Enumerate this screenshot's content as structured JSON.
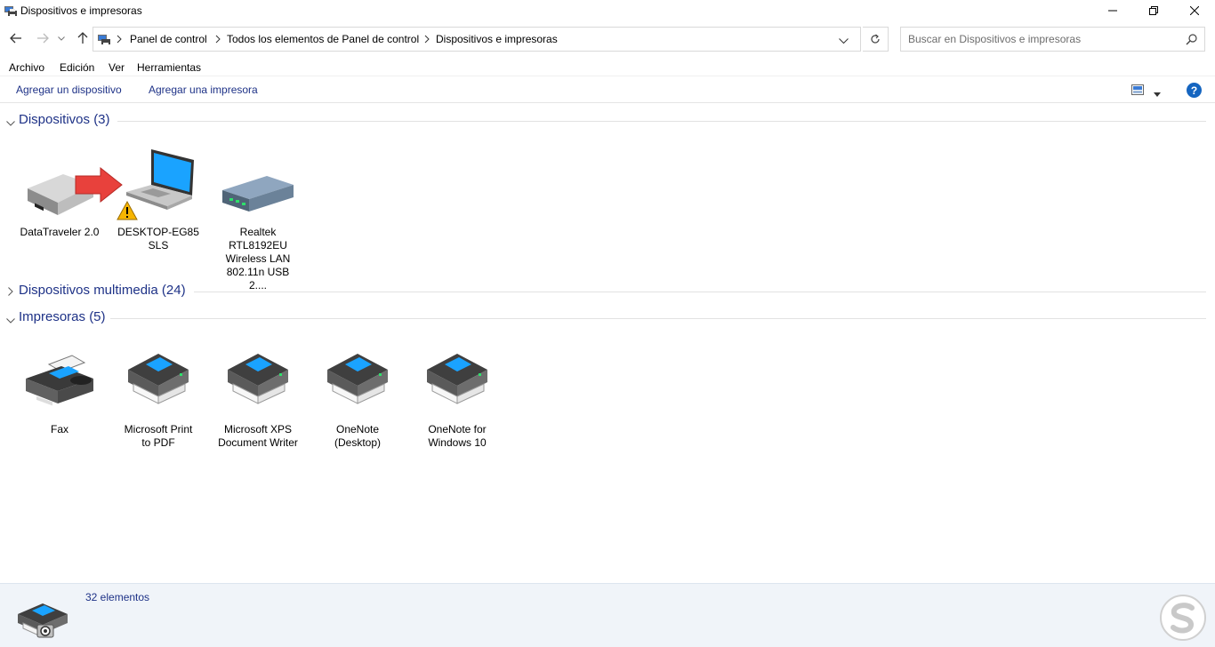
{
  "window": {
    "title": "Dispositivos e impresoras",
    "controls": [
      "minimize-icon",
      "restore-icon",
      "close-icon"
    ]
  },
  "address_bar": {
    "breadcrumbs": [
      "Panel de control",
      "Todos los elementos de Panel de control",
      "Dispositivos e impresoras"
    ]
  },
  "search": {
    "placeholder": "Buscar en Dispositivos e impresoras",
    "value": ""
  },
  "menu": [
    "Archivo",
    "Edición",
    "Ver",
    "Herramientas"
  ],
  "commands": {
    "add_device": "Agregar un dispositivo",
    "add_printer": "Agregar una impresora",
    "help": "?"
  },
  "groups": {
    "devices": {
      "title": "Dispositivos (3)",
      "expanded": true,
      "items": [
        {
          "label": "DataTraveler 2.0",
          "icon": "usb-drive-icon"
        },
        {
          "label": "DESKTOP-EG85SLS",
          "icon": "laptop-icon",
          "warning": true
        },
        {
          "label": "Realtek RTL8192EU Wireless LAN 802.11n USB 2....",
          "icon": "network-adapter-icon"
        }
      ]
    },
    "multimedia": {
      "title": "Dispositivos multimedia (24)",
      "expanded": false
    },
    "printers": {
      "title": "Impresoras (5)",
      "expanded": true,
      "items": [
        {
          "label": "Fax",
          "icon": "fax-icon"
        },
        {
          "label": "Microsoft Print to PDF",
          "icon": "printer-icon"
        },
        {
          "label": "Microsoft XPS Document Writer",
          "icon": "printer-icon"
        },
        {
          "label": "OneNote (Desktop)",
          "icon": "printer-icon"
        },
        {
          "label": "OneNote for Windows 10",
          "icon": "printer-icon"
        }
      ]
    }
  },
  "status": {
    "count": "32 elementos"
  },
  "colors": {
    "link_blue": "#1e3287",
    "status_bg": "#f0f4f9",
    "annotation_arrow": "#e8413c"
  }
}
